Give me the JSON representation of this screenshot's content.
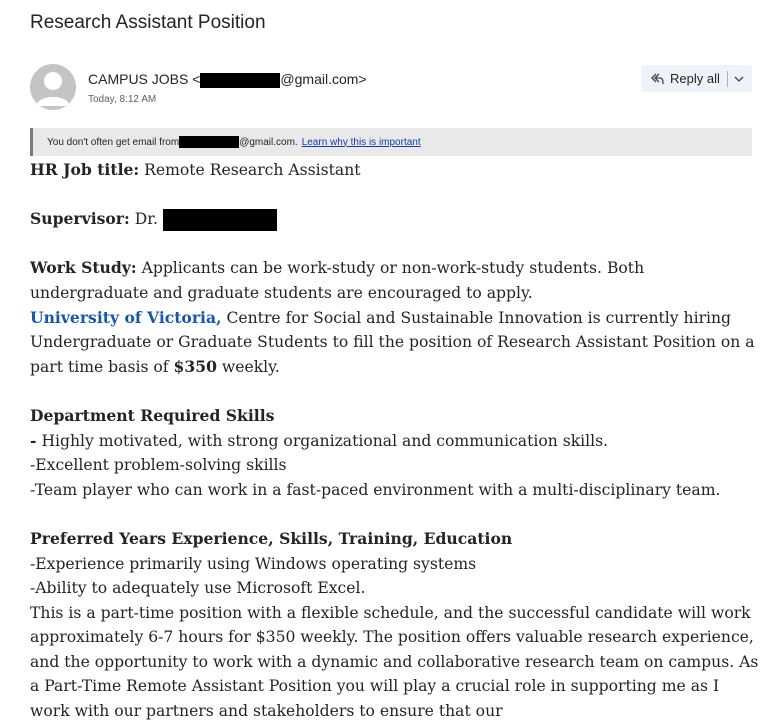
{
  "email": {
    "subject": "Research Assistant Position",
    "sender_name": "CAMPUS JOBS <",
    "sender_domain": "@gmail.com>",
    "timestamp": "Today, 8:12 AM",
    "reply_all_label": "Reply all",
    "notice_text": "You don't often get email from",
    "notice_domain": "@gmail.com.",
    "notice_link": "Learn why this is important",
    "icons": [
      "avatar-person-icon",
      "reply-all-icon",
      "chevron-down-icon"
    ]
  },
  "body": {
    "hr_label": "HR Job title:",
    "hr_value": " Remote Research Assistant",
    "supervisor_label": "Supervisor:",
    "supervisor_value": " Dr. ",
    "work_study_label": "Work Study:",
    "work_study_text": " Applicants can be work-study or non-work-study students. Both undergraduate and graduate students are encouraged to apply.",
    "uvic_name": "University of Victoria,",
    "uvic_text_1": " Centre for Social and Sustainable Innovation is currently hiring Undergraduate or Graduate Students to fill the position of Research Assistant Position on a part time basis of ",
    "pay": "$350",
    "uvic_text_2": " weekly.",
    "dept_heading": "Department Required Skills",
    "dept_dash": "-",
    "dept_item_1": " Highly motivated, with strong organizational and communication skills.",
    "dept_item_2": "-Excellent problem-solving skills",
    "dept_item_3": "-Team player who can work in a fast-paced environment with a multi-disciplinary team.",
    "pref_heading": "Preferred Years Experience, Skills, Training, Education",
    "pref_item_1": "-Experience primarily using Windows operating systems",
    "pref_item_2": "-Ability to adequately use Microsoft Excel.",
    "closing_text": "This is a part-time position with a flexible schedule, and the successful candidate will work approximately 6-7 hours for $350  weekly. The position offers valuable research experience, and the opportunity to work with a dynamic and collaborative research team on campus.  As a Part-Time Remote Assistant Position you will play a crucial role in supporting me as I work with our partners and stakeholders to ensure that our"
  }
}
